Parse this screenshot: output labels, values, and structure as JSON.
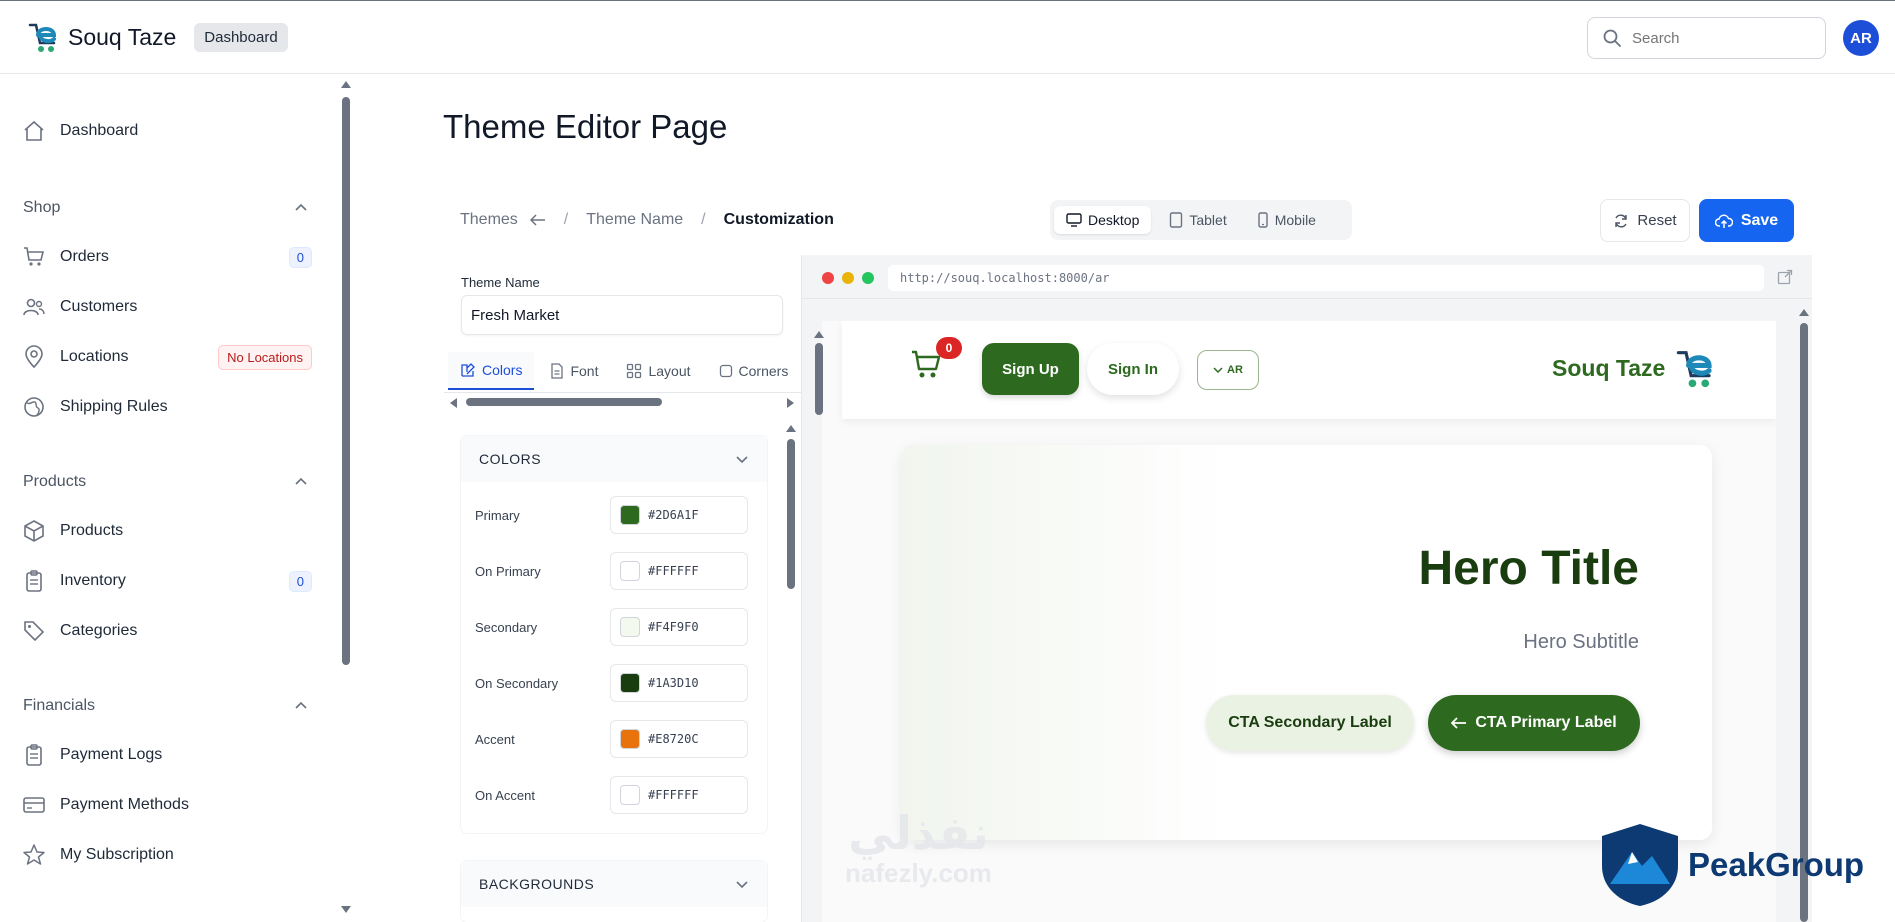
{
  "header": {
    "brand_name": "Souq Taze",
    "badge": "Dashboard",
    "search_placeholder": "Search",
    "avatar_initials": "AR"
  },
  "sidebar": {
    "dashboard": "Dashboard",
    "groups": [
      {
        "label": "Shop"
      },
      {
        "label": "Products"
      },
      {
        "label": "Financials"
      }
    ],
    "items": [
      {
        "label": "Orders",
        "count": "0"
      },
      {
        "label": "Customers"
      },
      {
        "label": "Locations",
        "badge": "No Locations"
      },
      {
        "label": "Shipping Rules"
      },
      {
        "label": "Products"
      },
      {
        "label": "Inventory",
        "count": "0"
      },
      {
        "label": "Categories"
      },
      {
        "label": "Payment Logs"
      },
      {
        "label": "Payment Methods"
      },
      {
        "label": "My Subscription"
      }
    ]
  },
  "page": {
    "title": "Theme Editor Page",
    "breadcrumb": [
      "Themes",
      "Theme Name",
      "Customization"
    ],
    "devices": [
      "Desktop",
      "Tablet",
      "Mobile"
    ],
    "reset_label": "Reset",
    "save_label": "Save"
  },
  "editor": {
    "theme_name_label": "Theme Name",
    "theme_name_value": "Fresh Market",
    "tabs": [
      "Colors",
      "Font",
      "Layout",
      "Corners"
    ],
    "colors_section": "COLORS",
    "backgrounds_section": "BACKGROUNDS",
    "colors": [
      {
        "label": "Primary",
        "hex": "#2D6A1F",
        "swatch": "#2D6A1F"
      },
      {
        "label": "On Primary",
        "hex": "#FFFFFF",
        "swatch": "#FFFFFF"
      },
      {
        "label": "Secondary",
        "hex": "#F4F9F0",
        "swatch": "#F4F9F0"
      },
      {
        "label": "On Secondary",
        "hex": "#1A3D10",
        "swatch": "#1A3D10"
      },
      {
        "label": "Accent",
        "hex": "#E8720C",
        "swatch": "#E8720C"
      },
      {
        "label": "On Accent",
        "hex": "#FFFFFF",
        "swatch": "#FFFFFF"
      }
    ]
  },
  "preview": {
    "url": "http://souq.localhost:8000/ar",
    "cart_count": "0",
    "sign_up": "Sign Up",
    "sign_in": "Sign In",
    "lang": "AR",
    "store_name": "Souq Taze",
    "hero_title": "Hero Title",
    "hero_subtitle": "Hero Subtitle",
    "cta_secondary": "CTA Secondary Label",
    "cta_primary": "CTA Primary Label"
  },
  "watermarks": {
    "peak": "PeakGroup",
    "nafezly_ar": "نفذلي",
    "nafezly": "nafezly.com"
  },
  "colors": {
    "brand_primary": "#2D6A1F",
    "save_blue": "#1565F0",
    "avatar_blue": "#1D4ED8"
  }
}
